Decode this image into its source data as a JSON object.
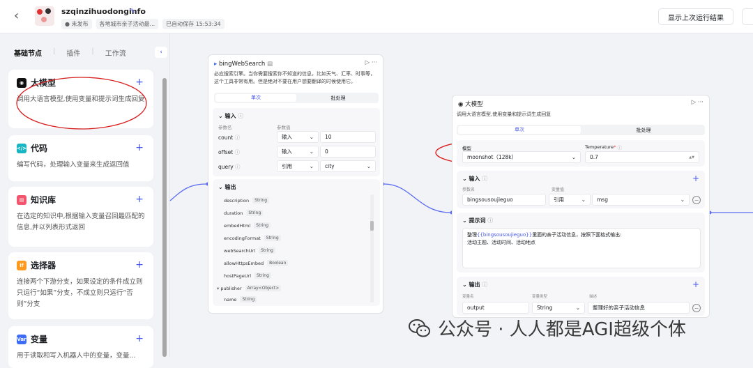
{
  "header": {
    "title": "szqinzihuodonginfo",
    "status": "未发布",
    "description": "各地城市亲子活动最...",
    "autosave": "已自动保存 15:53:34",
    "show_last_run": "显示上次运行结果"
  },
  "sidebar": {
    "tabs": [
      "基础节点",
      "插件",
      "工作流"
    ],
    "items": [
      {
        "label": "大模型",
        "desc": "调用大语言模型,使用变量和提示词生成回复",
        "icon_color": "#111111"
      },
      {
        "label": "代码",
        "desc": "编写代码，处理输入变量来生成返回值",
        "icon_color": "#17b6c2"
      },
      {
        "label": "知识库",
        "desc": "在选定的知识中,根据输入变量召回最匹配的信息,并以列表形式返回",
        "icon_color": "#f2566e"
      },
      {
        "label": "选择器",
        "desc": "连接两个下游分支，如果设定的条件成立则只运行“如果”分支，不成立则只运行“否则”分支",
        "icon_color": "#ff9a1f"
      },
      {
        "label": "变量",
        "desc": "用于读取和写入机器人中的变量，变量...",
        "icon_color": "#3e6cf6"
      }
    ]
  },
  "bing_node": {
    "title": "bingWebSearch",
    "desc": "必应搜索引擎。当你需要搜索你不知道的信息，比如天气、汇率、时事等，这个工具非常有用。但是绝对不要在用户想要翻译的时候使用它。",
    "tabs": [
      "单次",
      "批处理"
    ],
    "input_label": "输入",
    "col_name": "参数名",
    "col_value": "参数值",
    "inputs": [
      {
        "name": "count",
        "mode": "输入",
        "value": "10"
      },
      {
        "name": "offset",
        "mode": "输入",
        "value": "0"
      },
      {
        "name": "query",
        "mode": "引用",
        "value": "city"
      }
    ],
    "output_label": "输出",
    "outputs": [
      {
        "name": "description",
        "type": "String"
      },
      {
        "name": "duration",
        "type": "String"
      },
      {
        "name": "embedHtml",
        "type": "String"
      },
      {
        "name": "encodingFormat",
        "type": "String"
      },
      {
        "name": "webSearchUrl",
        "type": "String"
      },
      {
        "name": "allowHttpsEmbed",
        "type": "Boolean"
      },
      {
        "name": "hostPageUrl",
        "type": "String"
      },
      {
        "name": "publisher",
        "type": "Array<Object>"
      },
      {
        "name": "name",
        "type": "String"
      }
    ]
  },
  "llm_node": {
    "title": "大模型",
    "desc": "调用大语言模型,使用变量和提示词生成回复",
    "tabs": [
      "单次",
      "批处理"
    ],
    "model_label": "模型",
    "model": "moonshot（128k）",
    "temp_label": "Temperature",
    "temp": "0.7",
    "input_label": "输入",
    "col_name": "参数名",
    "col_value": "变量值",
    "input_name": "bingsousoujieguo",
    "input_mode": "引用",
    "input_value": "msg",
    "prompt_label": "提示词",
    "prompt_ref": "{{bingsousoujieguo}}",
    "prompt_pre": "整理",
    "prompt_post": "里面的亲子活动信息，按照下面格式输出:",
    "prompt_line2": "活动主题、活动时间、活动地点",
    "output_label": "输出",
    "out_cols": [
      "变量名",
      "变量类型",
      "描述"
    ],
    "out_name": "output",
    "out_type": "String",
    "out_desc": "整理好的亲子活动信息"
  },
  "watermark": "公众号 · 人人都是AGI超级个体"
}
